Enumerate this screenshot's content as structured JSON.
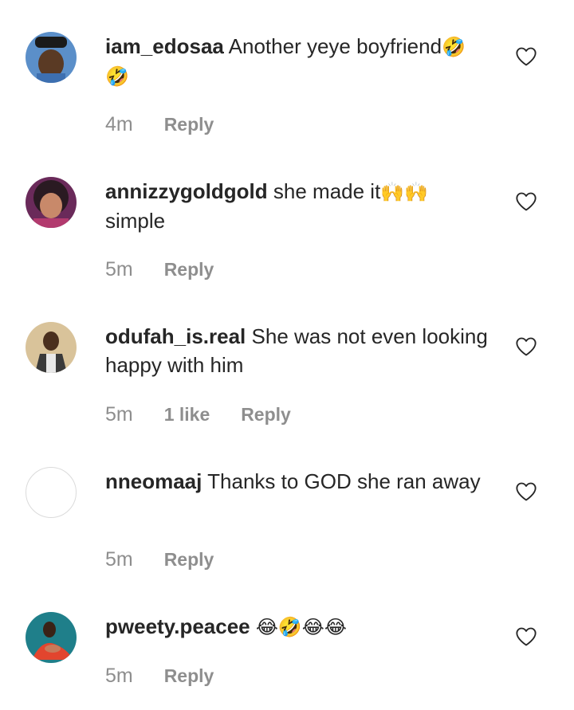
{
  "comments": [
    {
      "username": "iam_edosaa",
      "text": "Another yeye boyfriend",
      "emoji": "🤣🤣",
      "time": "4m",
      "reply": "Reply"
    },
    {
      "username": "annizzygoldgold",
      "text": "she made it",
      "emoji": "🙌🙌",
      "text2": "simple",
      "time": "5m",
      "reply": "Reply"
    },
    {
      "username": "odufah_is.real",
      "text": "She was not even looking happy with him",
      "time": "5m",
      "likes": "1 like",
      "reply": "Reply"
    },
    {
      "username": "nneomaaj",
      "text": "Thanks to GOD she ran away",
      "time": "5m",
      "reply": "Reply"
    },
    {
      "username": "pweety.peacee",
      "emoji": "😂🤣😂😂",
      "time": "5m",
      "reply": "Reply"
    }
  ],
  "icons": {
    "like": "heart-outline-icon"
  },
  "colors": {
    "text": "#262626",
    "meta": "#8e8e8e",
    "heart": "#262626"
  }
}
